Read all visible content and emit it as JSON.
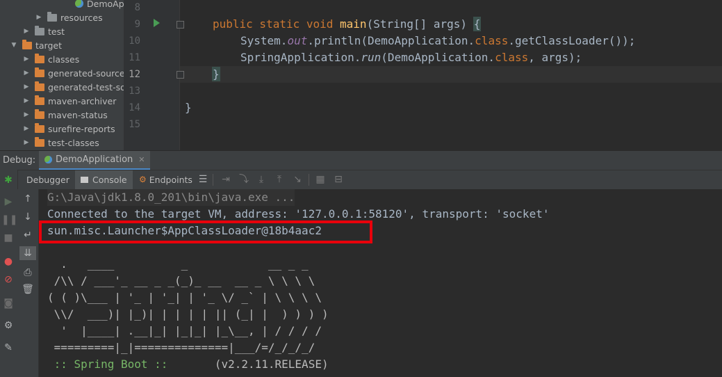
{
  "project_tree": {
    "demo_app_label": "DemoAp",
    "items": [
      {
        "label": "resources",
        "type": "grey",
        "expanded": false
      },
      {
        "label": "test",
        "type": "grey",
        "expanded": false
      },
      {
        "label": "target",
        "type": "orange",
        "expanded": true
      },
      {
        "label": "classes",
        "type": "orange",
        "expanded": false
      },
      {
        "label": "generated-sources",
        "type": "orange",
        "expanded": false
      },
      {
        "label": "generated-test-so",
        "type": "orange",
        "expanded": false
      },
      {
        "label": "maven-archiver",
        "type": "orange",
        "expanded": false
      },
      {
        "label": "maven-status",
        "type": "orange",
        "expanded": false
      },
      {
        "label": "surefire-reports",
        "type": "orange",
        "expanded": false
      },
      {
        "label": "test-classes",
        "type": "orange",
        "expanded": false
      }
    ]
  },
  "editor": {
    "line_numbers": [
      "8",
      "9",
      "10",
      "11",
      "12",
      "13",
      "14",
      "15"
    ],
    "line9": {
      "kw1": "public static void ",
      "fn": "main",
      "rest": "(String[] args) ",
      "brace": "{"
    },
    "line10": {
      "a": "System.",
      "b": "out",
      "c": ".println(DemoApplication.",
      "d": "class",
      "e": ".getClassLoader());"
    },
    "line11": {
      "a": "SpringApplication.",
      "b": "run",
      "c": "(DemoApplication.",
      "d": "class",
      "e": ", args);"
    },
    "line12": {
      "brace": "}"
    },
    "line14": {
      "brace": "}"
    }
  },
  "debug": {
    "title": "Debug:",
    "session_tab": "DemoApplication",
    "tabs": [
      "Debugger",
      "Console",
      "Endpoints"
    ]
  },
  "console": {
    "cmd": "G:\\Java\\jdk1.8.0_201\\bin\\java.exe ...",
    "connected": "Connected to the target VM, address: '127.0.0.1:58120', transport: 'socket'",
    "classloader": "sun.misc.Launcher$AppClassLoader@18b4aac2",
    "banner": [
      "  .   ____          _            __ _ _",
      " /\\\\ / ___'_ __ _ _(_)_ __  __ _ \\ \\ \\ \\",
      "( ( )\\___ | '_ | '_| | '_ \\/ _` | \\ \\ \\ \\",
      " \\\\/  ___)| |_)| | | | | || (_| |  ) ) ) )",
      "  '  |____| .__|_| |_|_| |_\\__, | / / / /",
      " =========|_|==============|___/=/_/_/_/"
    ],
    "spring_boot_label": " :: Spring Boot :: ",
    "spring_boot_version": "      (v2.2.11.RELEASE)"
  },
  "colors": {
    "highlight_border": "#e8000b",
    "keyword": "#cc7832",
    "method": "#ffc66d"
  }
}
